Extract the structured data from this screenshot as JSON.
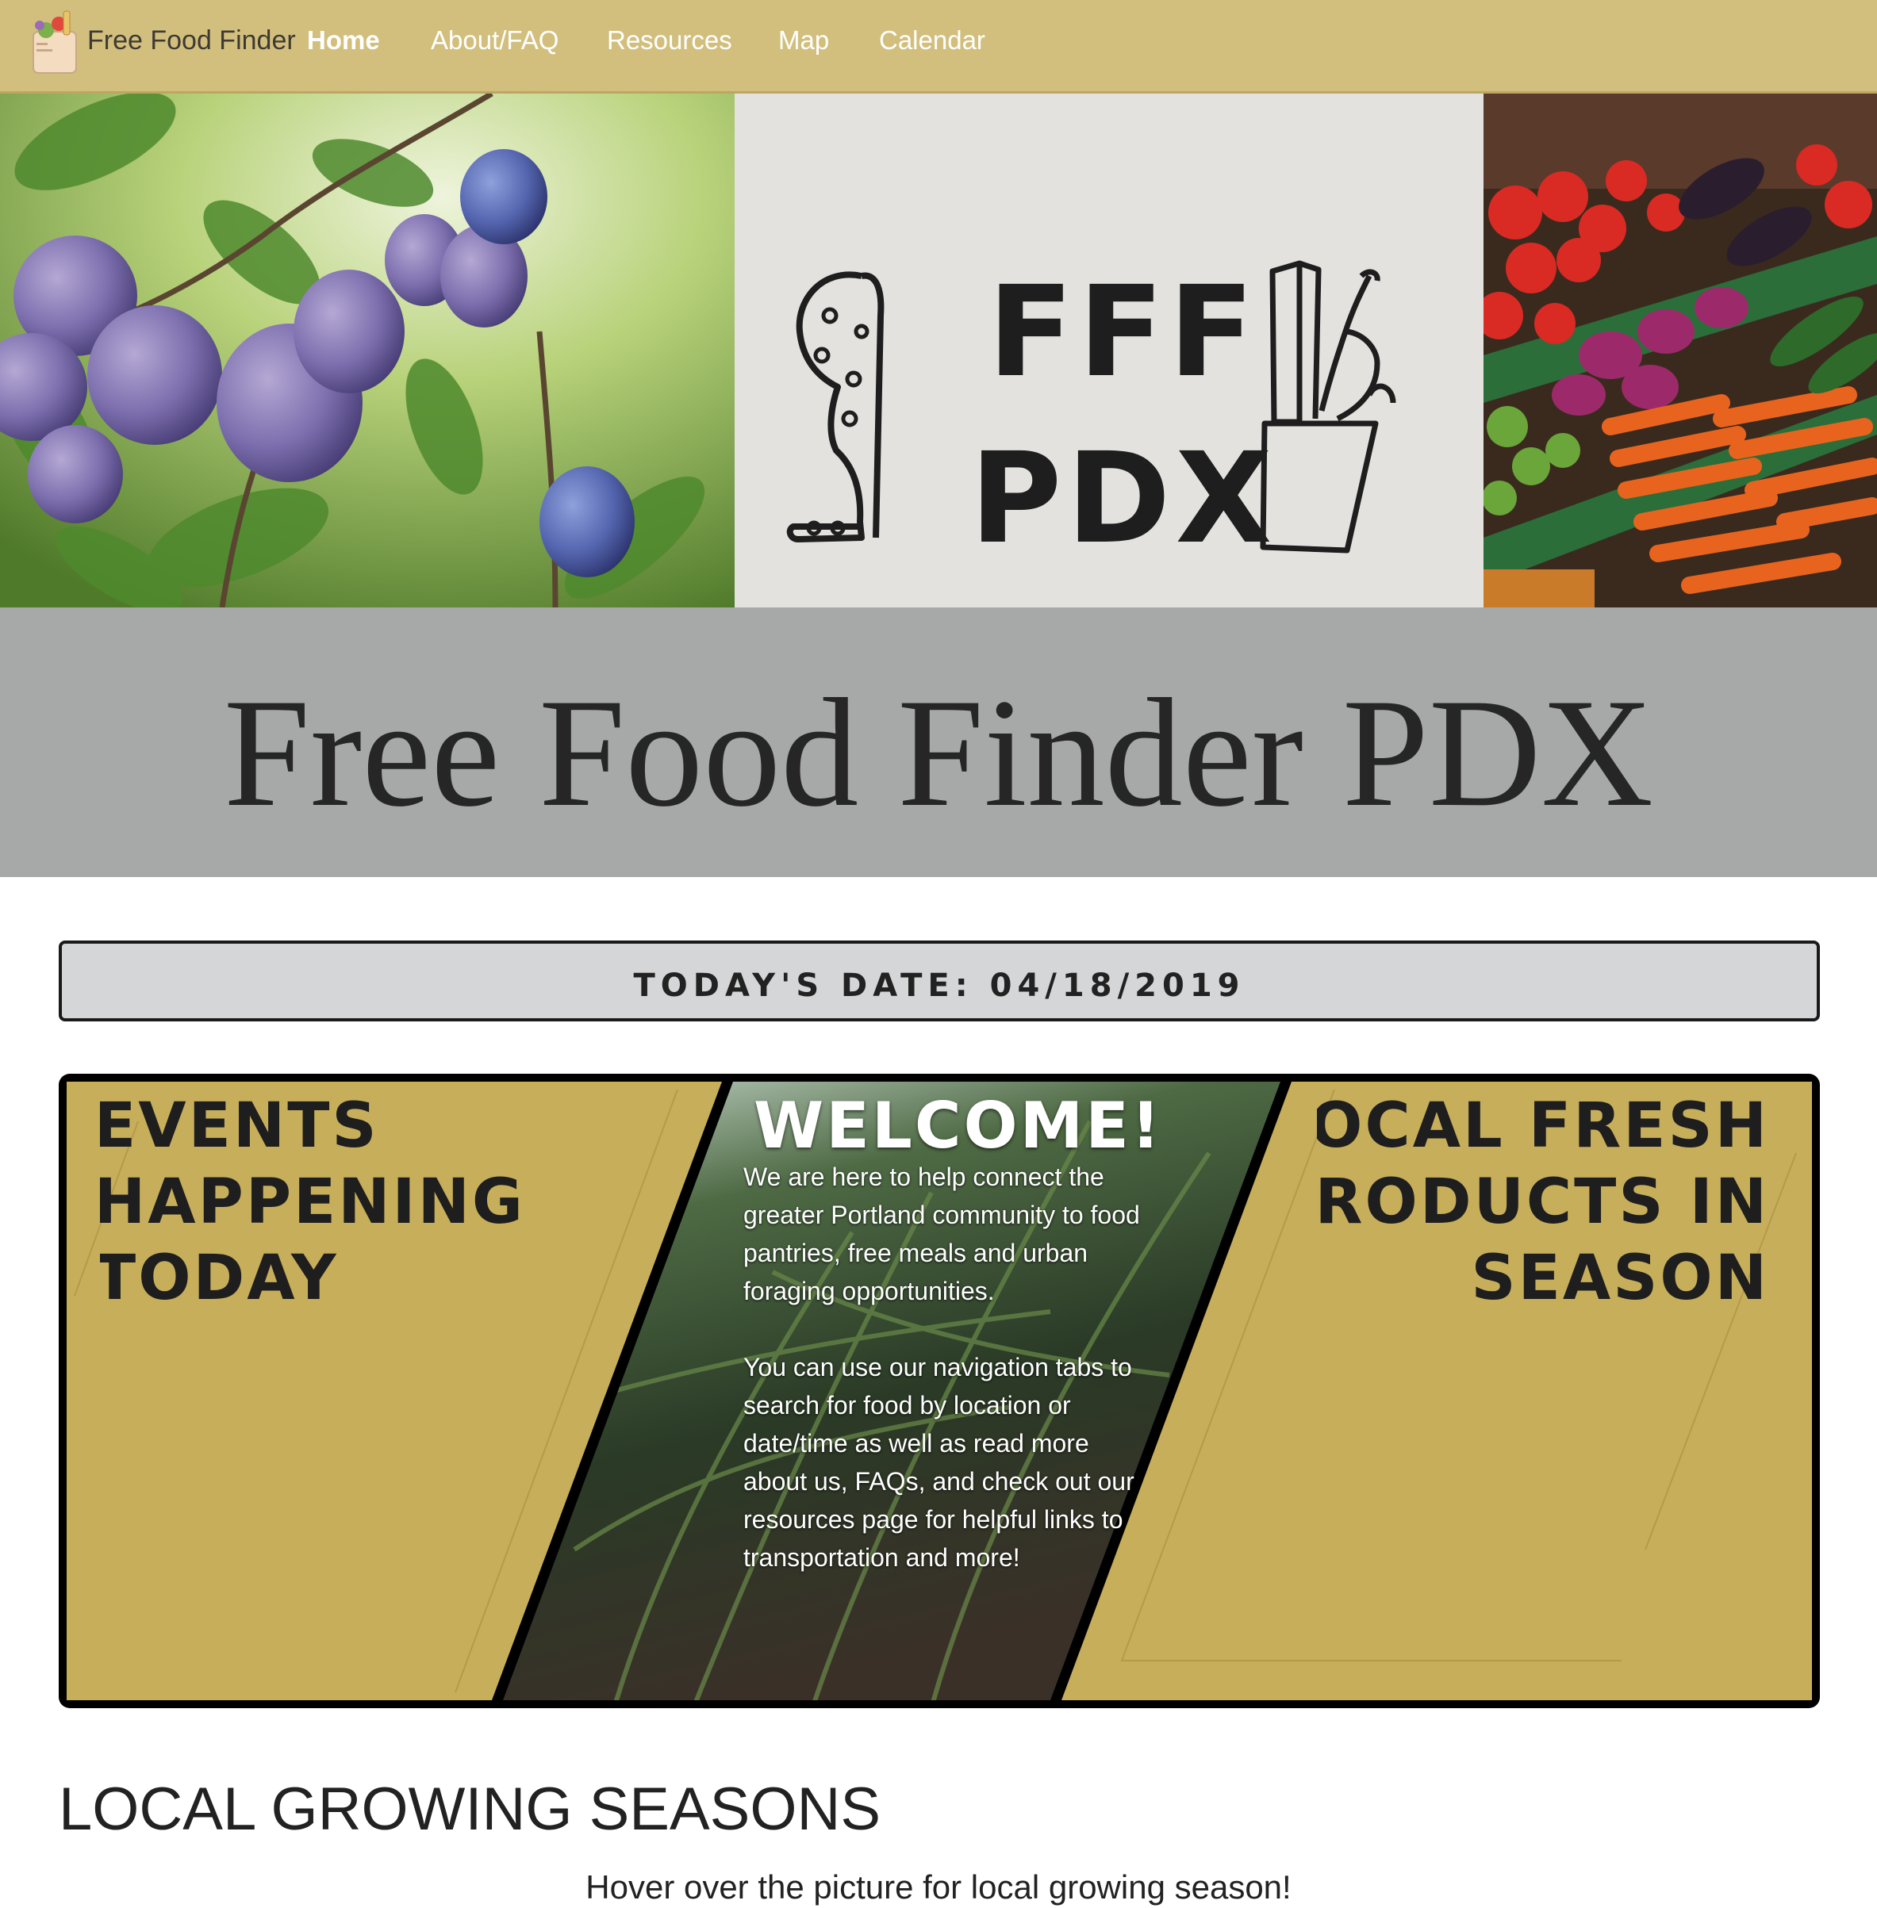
{
  "navbar": {
    "brand": "Free Food Finder",
    "items": [
      {
        "label": "Home",
        "active": true
      },
      {
        "label": "About/FAQ",
        "active": false
      },
      {
        "label": "Resources",
        "active": false
      },
      {
        "label": "Map",
        "active": false
      },
      {
        "label": "Calendar",
        "active": false
      }
    ]
  },
  "hero": {
    "logo_line1": "FFF",
    "logo_line2": "PDX"
  },
  "title": "Free Food Finder PDX",
  "date": {
    "text": "TODAY'S DATE: 04/18/2019"
  },
  "panels": {
    "events": {
      "line1": "EVENTS",
      "line2": "HAPPENING",
      "line3": "TODAY"
    },
    "welcome": {
      "heading": "WELCOME!",
      "paragraph1": "We are here to help connect the greater Portland community to food pantries, free meals and urban foraging opportunities.",
      "paragraph2": "You can use our navigation tabs to search for food by location or date/time as well as read more about us, FAQs, and check out our resources page for helpful links to transportation and more!"
    },
    "fresh": {
      "line1": "LOCAL FRESH",
      "line2": "PRODUCTS IN",
      "line3": "SEASON"
    }
  },
  "seasons": {
    "heading": "LOCAL GROWING SEASONS",
    "subtext": "Hover over the picture for local growing season!"
  },
  "colors": {
    "navbar": "#d2bf7d",
    "title_band": "#a6a9a8",
    "panel_gold": "#c7ae5b",
    "date_box": "#d5d6d7"
  }
}
